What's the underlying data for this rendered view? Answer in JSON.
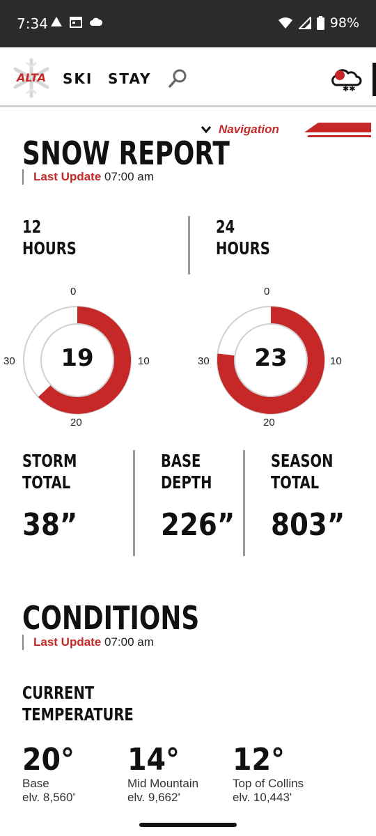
{
  "status_bar": {
    "time": "7:34",
    "battery": "98%"
  },
  "header": {
    "logo_text": "ALTA",
    "nav": {
      "ski": "SKI",
      "stay": "STAY"
    }
  },
  "navigation_label": "Navigation",
  "snow_report": {
    "title": "SNOW REPORT",
    "update_label": "Last Update",
    "update_time": "07:00 am",
    "h12": {
      "line1": "12",
      "line2": "HOURS",
      "value": "19",
      "fraction": 0.63
    },
    "h24": {
      "line1": "24",
      "line2": "HOURS",
      "value": "23",
      "fraction": 0.77
    },
    "ticks": {
      "top": "0",
      "right": "10",
      "bottom": "20",
      "left": "30"
    },
    "storm": {
      "line1": "STORM",
      "line2": "TOTAL",
      "value": "38”"
    },
    "base": {
      "line1": "BASE",
      "line2": "DEPTH",
      "value": "226”"
    },
    "season": {
      "line1": "SEASON",
      "line2": "TOTAL",
      "value": "803”"
    }
  },
  "conditions": {
    "title": "CONDITIONS",
    "update_label": "Last Update",
    "update_time": "07:00 am",
    "current_temp": {
      "line1": "CURRENT",
      "line2": "TEMPERATURE"
    },
    "temps": [
      {
        "value": "20°",
        "location": "Base",
        "elevation": "elv. 8,560'"
      },
      {
        "value": "14°",
        "location": "Mid Mountain",
        "elevation": "elv. 9,662'"
      },
      {
        "value": "12°",
        "location": "Top of Collins",
        "elevation": "elv. 10,443'"
      }
    ]
  },
  "colors": {
    "accent": "#c62828",
    "dark": "#111111",
    "status_bar": "#2b2b2b"
  }
}
